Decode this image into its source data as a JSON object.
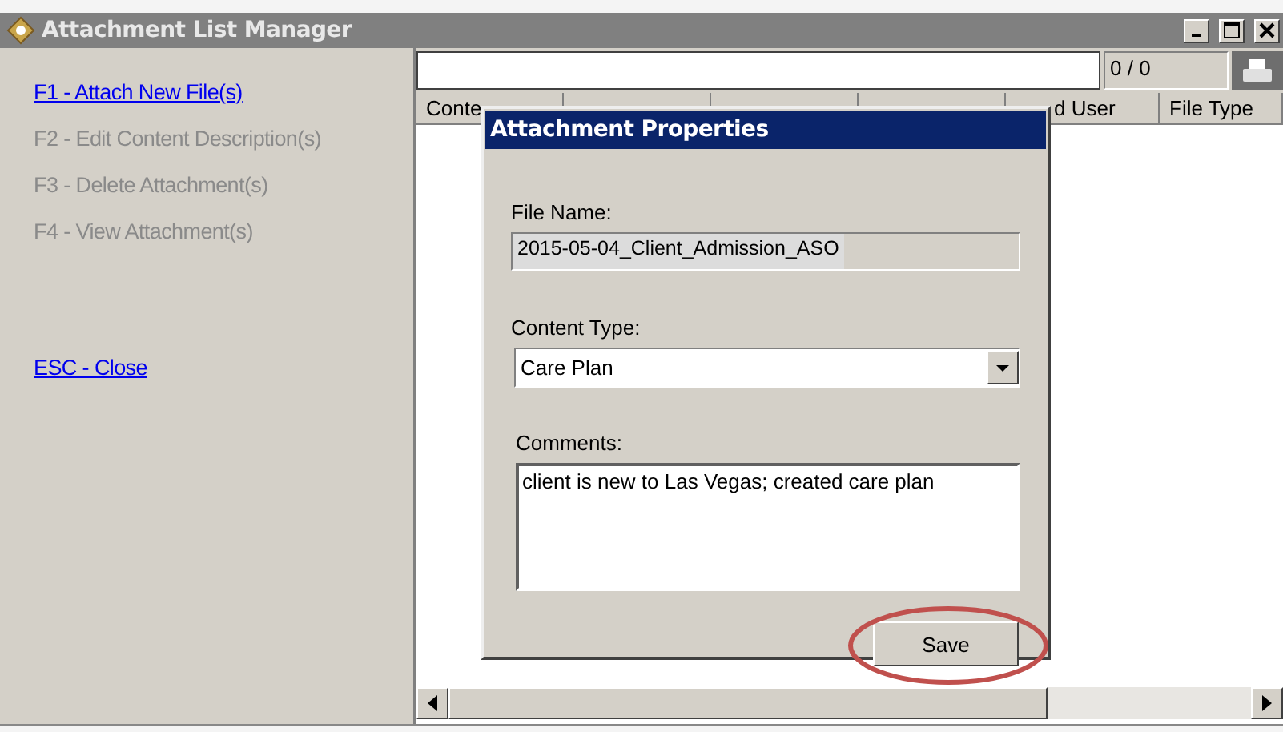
{
  "window": {
    "title": "Attachment List Manager"
  },
  "actions": [
    {
      "label": "F1 - Attach New File(s)",
      "disabled": false
    },
    {
      "label": "F2 - Edit Content Description(s)",
      "disabled": true
    },
    {
      "label": "F3 - Delete Attachment(s)",
      "disabled": true
    },
    {
      "label": "F4 - View Attachment(s)",
      "disabled": true
    }
  ],
  "close_action": {
    "label": "ESC - Close",
    "disabled": false
  },
  "counter": "0 / 0",
  "table": {
    "columns": [
      "Conte",
      "",
      "",
      "",
      "d User",
      "File Type"
    ]
  },
  "dialog": {
    "title": "Attachment Properties",
    "file_name": {
      "label": "File Name:",
      "value": "2015-05-04_Client_Admission_ASO"
    },
    "content_type": {
      "label": "Content Type:",
      "value": "Care Plan"
    },
    "comments": {
      "label": "Comments:",
      "value": "client is new to Las Vegas; created care plan"
    },
    "save_button": "Save"
  }
}
